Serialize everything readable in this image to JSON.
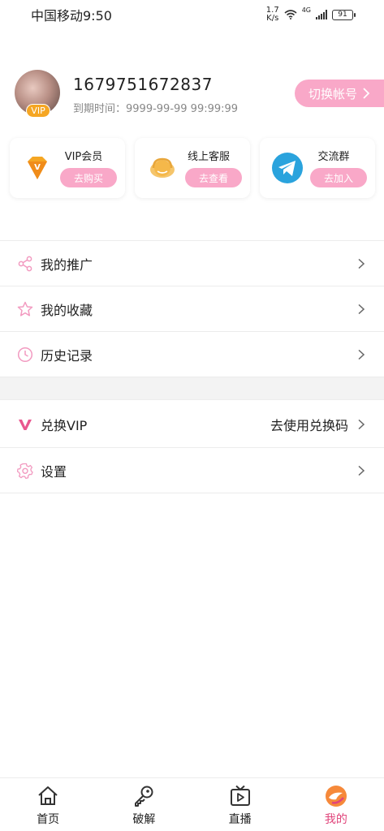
{
  "status_bar": {
    "carrier_time": "中国移动9:50",
    "net_speed_value": "1.7",
    "net_speed_unit": "K/s",
    "network": "4G",
    "battery": "91"
  },
  "profile": {
    "vip_badge": "VIP",
    "user_id": "1679751672837",
    "expire_text": "到期时间：9999-99-99 99:99:99",
    "switch_label": "切换帐号"
  },
  "cards": [
    {
      "title": "VIP会员",
      "button": "去购买",
      "icon": "diamond-v-icon"
    },
    {
      "title": "线上客服",
      "button": "去查看",
      "icon": "headset-icon"
    },
    {
      "title": "交流群",
      "button": "去加入",
      "icon": "telegram-icon"
    }
  ],
  "menu_group1": [
    {
      "label": "我的推广",
      "icon": "share-icon"
    },
    {
      "label": "我的收藏",
      "icon": "star-icon"
    },
    {
      "label": "历史记录",
      "icon": "clock-icon"
    }
  ],
  "menu_group2": [
    {
      "label": "兑换VIP",
      "right": "去使用兑换码",
      "icon": "vip-v-icon"
    },
    {
      "label": "设置",
      "icon": "gear-icon"
    }
  ],
  "tabs": [
    {
      "label": "首页",
      "icon": "home-icon"
    },
    {
      "label": "破解",
      "icon": "key-icon"
    },
    {
      "label": "直播",
      "icon": "tv-icon"
    },
    {
      "label": "我的",
      "icon": "profile-logo-icon",
      "active": true
    }
  ],
  "colors": {
    "accent_pink": "#f9a8c8",
    "active_tab": "#e0457b",
    "vip_orange": "#f5a623"
  }
}
